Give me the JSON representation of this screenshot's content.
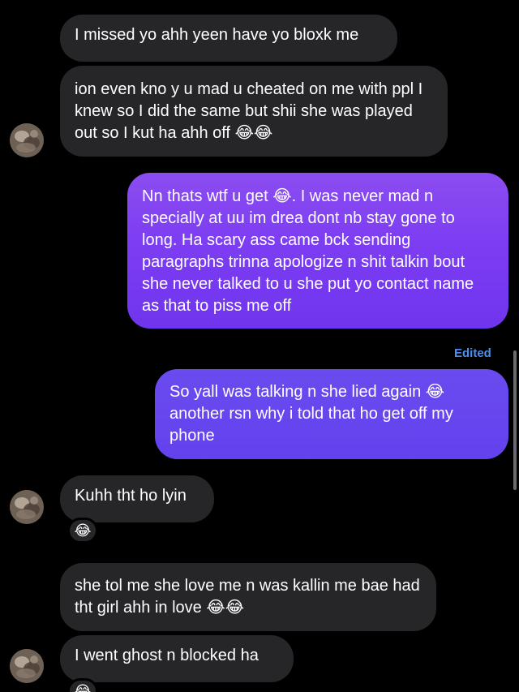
{
  "messages": [
    {
      "id": "m1",
      "direction": "incoming",
      "text": "I missed yo ahh yeen have yo bloxk me"
    },
    {
      "id": "m2",
      "direction": "incoming",
      "text": "ion even kno y u mad u cheated on me with ppl I knew so I did the same but shii she was played out so I kut ha ahh off",
      "emoji_suffix": "😂😂"
    },
    {
      "id": "m3",
      "direction": "outgoing",
      "text_before_emoji": "Nn thats wtf u get",
      "emoji": "😂",
      "text_after_emoji": ". I was never mad n specially at uu im drea dont nb stay gone to long. Ha scary ass came bck sending paragraphs trinna apologize n shit talkin bout she never talked to u she put yo contact name as that to piss me off"
    },
    {
      "id": "m4",
      "direction": "outgoing",
      "edited_label": "Edited",
      "text_before_emoji": "So yall was talking n she lied again",
      "emoji": "😂",
      "text_after_emoji": "another rsn why i told that ho get off my phone"
    },
    {
      "id": "m5",
      "direction": "incoming",
      "text": "Kuhh tht ho lyin",
      "reaction": "😂"
    },
    {
      "id": "m6",
      "direction": "incoming",
      "text": "she tol me she love me n was kallin me bae had tht girl ahh in love",
      "emoji_suffix": "😂😂"
    },
    {
      "id": "m7",
      "direction": "incoming",
      "text": "I went ghost n blocked ha",
      "reaction": "😂"
    }
  ],
  "colors": {
    "background": "#000000",
    "incoming_bubble": "#262629",
    "outgoing_bubble": "#7d3df2",
    "edited_label": "#4a8ff0"
  },
  "icons": {
    "avatar": "contact-avatar",
    "emoji": "face-with-tears-of-joy"
  }
}
